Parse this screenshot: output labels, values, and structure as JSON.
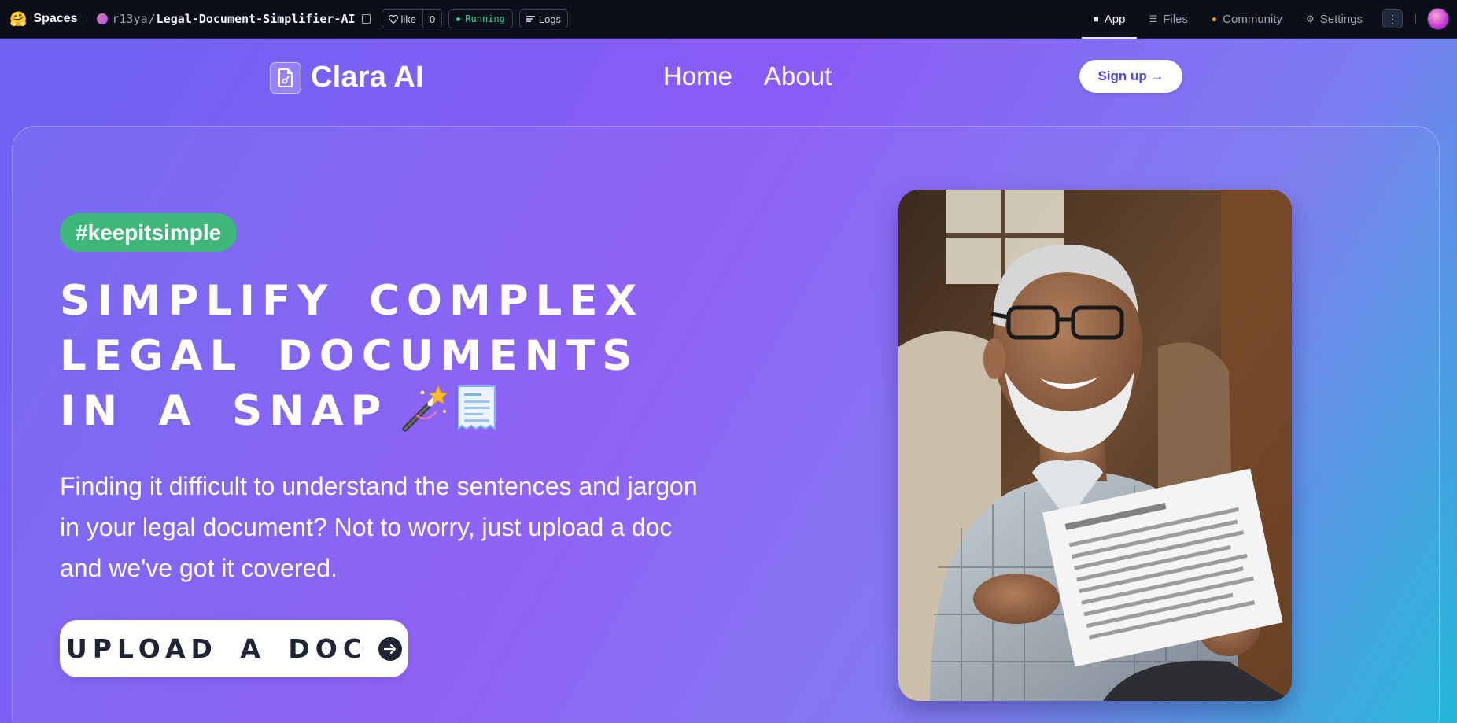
{
  "hf_bar": {
    "spaces_label": "Spaces",
    "repo_owner": "r13ya",
    "repo_name": "Legal-Document-Simplifier-AI",
    "like_label": "like",
    "like_count": "0",
    "status": "Running",
    "logs_label": "Logs",
    "tabs": [
      {
        "label": "App",
        "icon": "cube-icon",
        "active": true
      },
      {
        "label": "Files",
        "icon": "files-icon",
        "active": false
      },
      {
        "label": "Community",
        "icon": "community-icon",
        "active": false
      },
      {
        "label": "Settings",
        "icon": "gear-icon",
        "active": false
      }
    ],
    "status_color": "#34d399"
  },
  "nav": {
    "brand": "Clara AI",
    "links": [
      "Home",
      "About"
    ],
    "signup_label": "Sign up →"
  },
  "hero": {
    "tag": "#keepitsimple",
    "headline_lines": [
      "Simplify complex",
      "legal documents",
      "in a snap"
    ],
    "headline_emojis": [
      "magic-wand-icon",
      "receipt-icon"
    ],
    "description": "Finding it difficult to understand the sentences and jargon in your legal document? Not to worry, just upload a doc and we've got it covered.",
    "upload_label": "Upload a doc",
    "tag_color": "#3db87a",
    "image": "photo-elderly-man-reading-document"
  },
  "colors": {
    "gradient_start": "#6c63f0",
    "gradient_mid": "#8b5cf6",
    "gradient_end": "#22b8d8",
    "signup_text": "#4f46e5",
    "button_text": "#1e2433"
  }
}
